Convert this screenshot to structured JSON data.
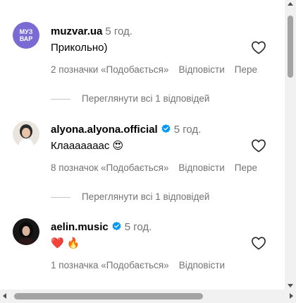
{
  "comments": [
    {
      "username": "muzvar.ua",
      "verified": false,
      "time": "5 год.",
      "text": "Прикольно)",
      "likes": "2 позначки «Подобається»",
      "reply": "Відповісти",
      "more": "Пере",
      "avatar_text": [
        "МУЗ",
        "ВАР"
      ],
      "view_replies": "Переглянути всі 1 відповідей"
    },
    {
      "username": "alyona.alyona.official",
      "verified": true,
      "time": "5 год.",
      "text": "Клааааааас 😍",
      "likes": "8 позначок «Подобається»",
      "reply": "Відповісти",
      "more": "Пере",
      "view_replies": "Переглянути всі 1 відповідей"
    },
    {
      "username": "aelin.music",
      "verified": true,
      "time": "5 год.",
      "text": "❤️ 🔥",
      "likes": "1 позначка «Подобається»",
      "reply": "Відповісти"
    }
  ],
  "colors": {
    "verified": "#0095f6",
    "secondary": "#737373"
  }
}
